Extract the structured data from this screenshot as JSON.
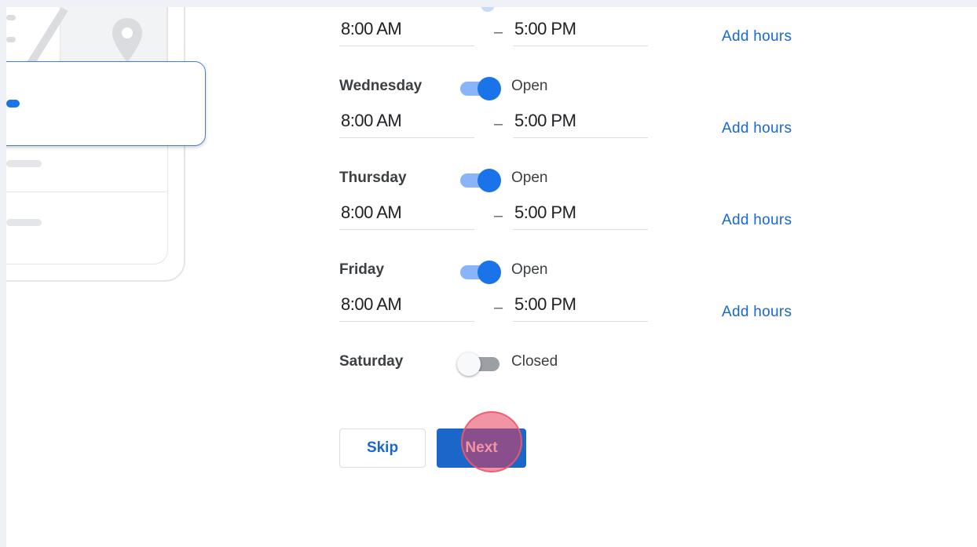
{
  "colors": {
    "accent": "#1a73e8",
    "link": "#1967d2",
    "toggle_on_track": "#8ab4f8",
    "toggle_off_track": "#9aa0a6",
    "click_indicator": "#e63c5a"
  },
  "illustration": {
    "icons": [
      "map-pin-icon",
      "menu-icon"
    ]
  },
  "hours": {
    "top_row": {
      "open_time": "8:00 AM",
      "close_time": "5:00 PM",
      "add_hours": "Add hours"
    },
    "days": [
      {
        "name": "Wednesday",
        "status": "Open",
        "open": true,
        "open_time": "8:00 AM",
        "close_time": "5:00 PM",
        "add_hours": "Add hours"
      },
      {
        "name": "Thursday",
        "status": "Open",
        "open": true,
        "open_time": "8:00 AM",
        "close_time": "5:00 PM",
        "add_hours": "Add hours"
      },
      {
        "name": "Friday",
        "status": "Open",
        "open": true,
        "open_time": "8:00 AM",
        "close_time": "5:00 PM",
        "add_hours": "Add hours"
      },
      {
        "name": "Saturday",
        "status": "Closed",
        "open": false
      }
    ],
    "separator": "–"
  },
  "actions": {
    "skip_label": "Skip",
    "next_label": "Next"
  }
}
